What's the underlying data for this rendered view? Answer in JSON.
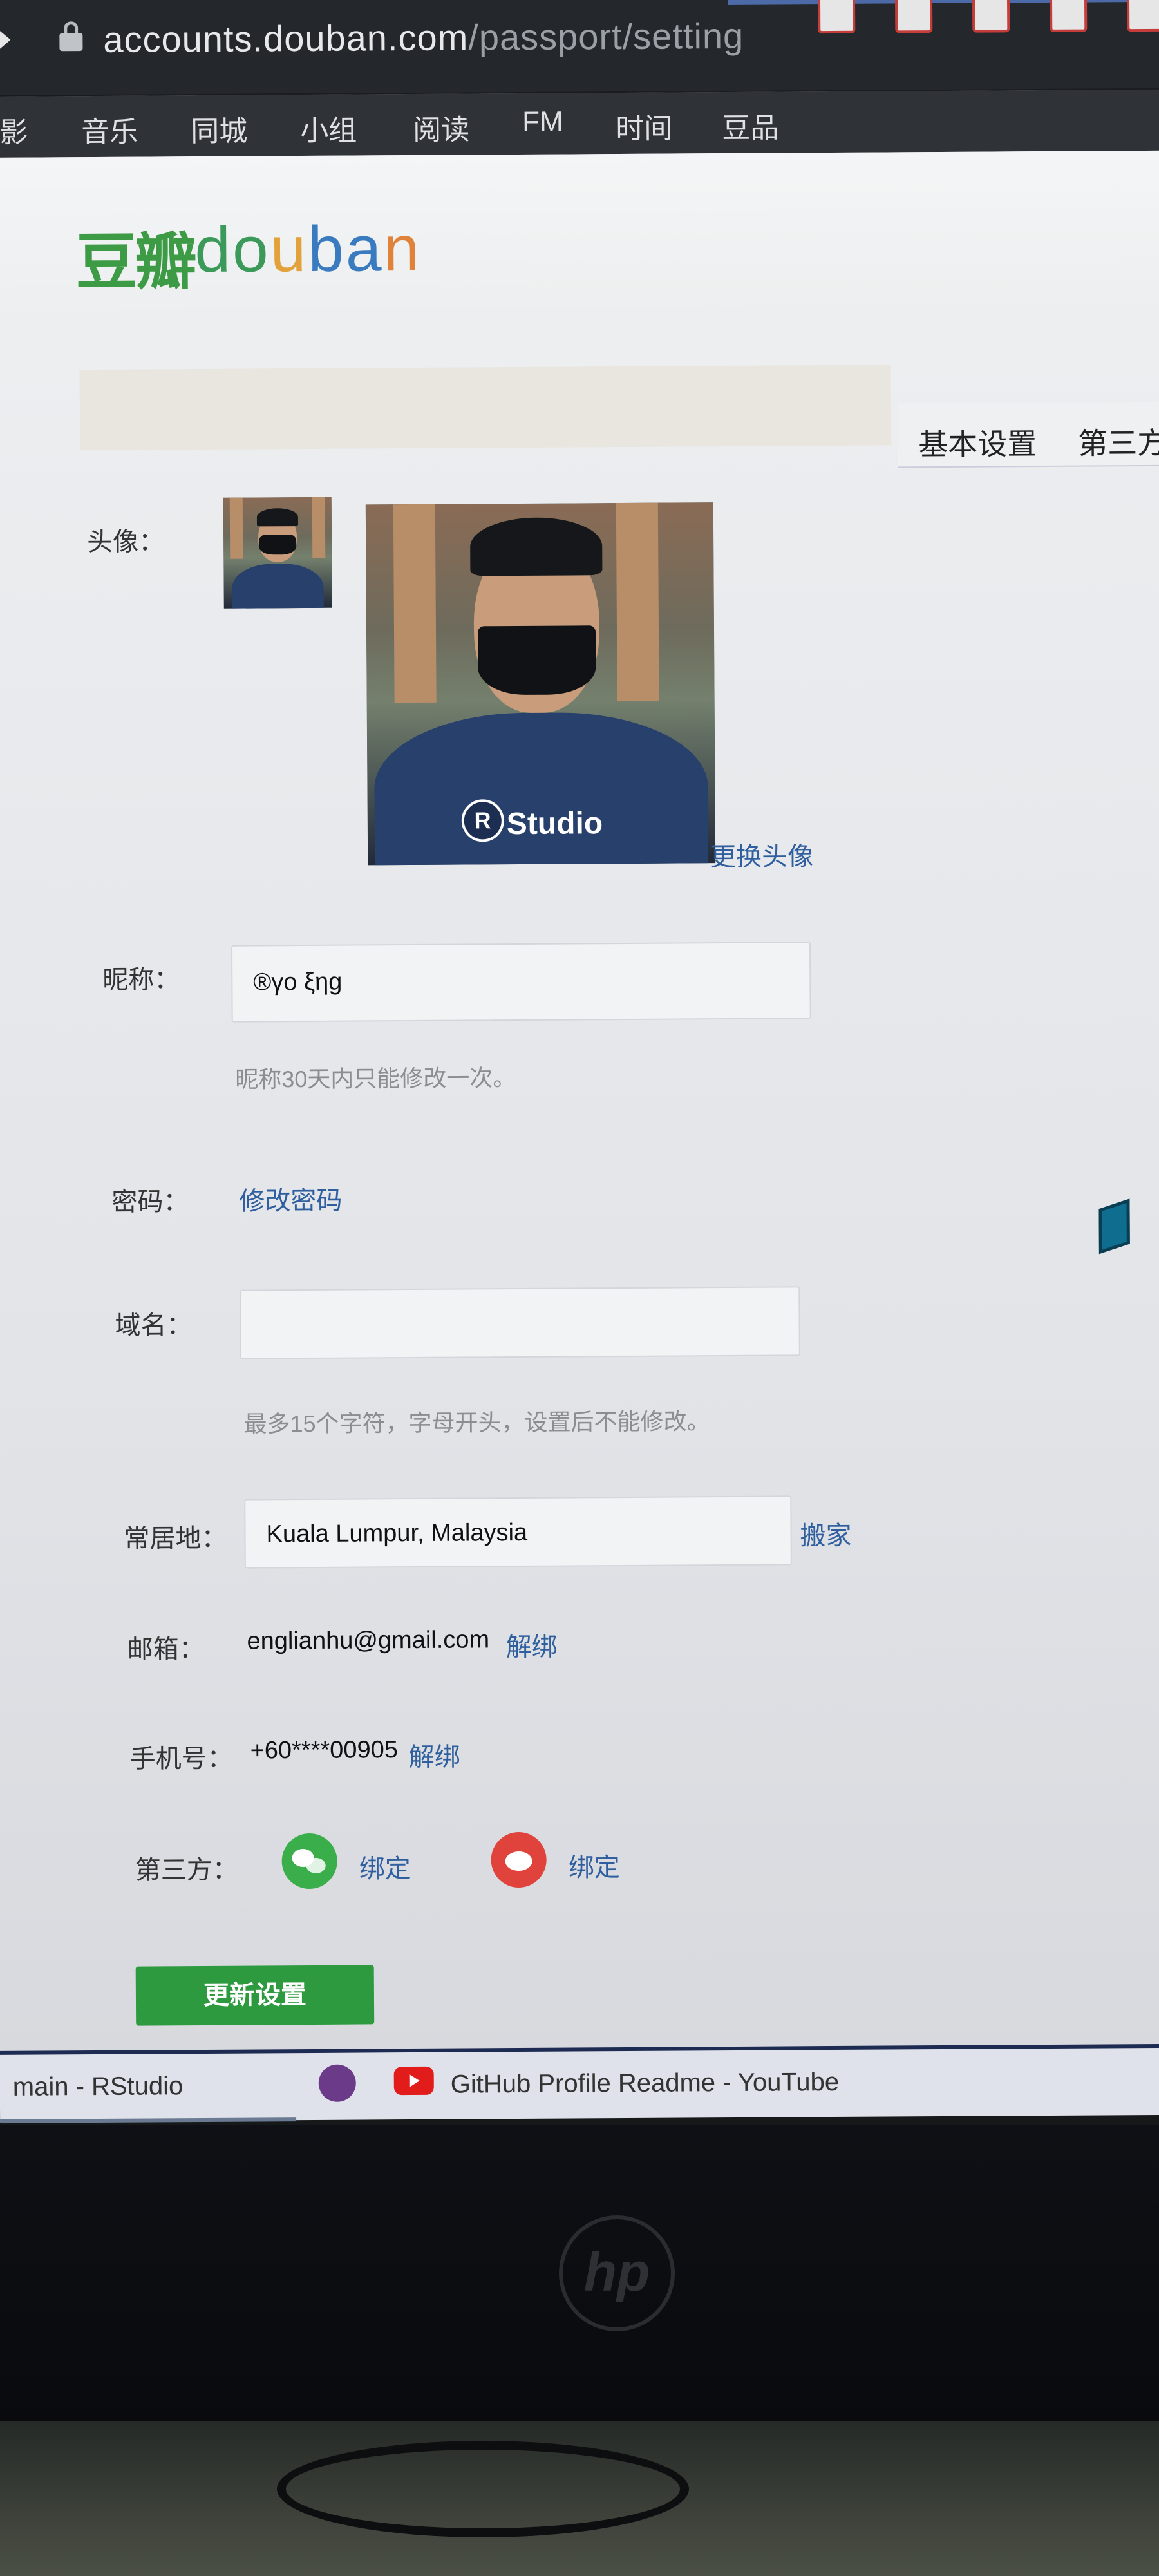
{
  "browser": {
    "url_host": "accounts.douban.com",
    "url_path": "/passport/setting"
  },
  "nav": {
    "items": [
      "影",
      "音乐",
      "同城",
      "小组",
      "阅读",
      "FM",
      "时间",
      "豆品"
    ]
  },
  "logo": {
    "cn": "豆瓣",
    "en_parts": [
      "do",
      "u",
      "ba",
      "n"
    ]
  },
  "tabs": [
    "基本设置",
    "第三方"
  ],
  "form": {
    "avatar_label": "头像：",
    "change_avatar": "更换头像",
    "nickname_label": "昵称：",
    "nickname_value": "®γο ξηg",
    "nickname_hint": "昵称30天内只能修改一次。",
    "password_label": "密码：",
    "password_link": "修改密码",
    "domain_label": "域名：",
    "domain_value": "",
    "domain_hint": "最多15个字符，字母开头，设置后不能修改。",
    "location_label": "常居地：",
    "location_value": "Kuala Lumpur, Malaysia",
    "location_link": "搬家",
    "email_label": "邮箱：",
    "email_value": "englianhu@gmail.com",
    "email_link": "解绑",
    "phone_label": "手机号：",
    "phone_value": "+60****00905",
    "phone_link": "解绑",
    "thirdparty_label": "第三方：",
    "wechat_bind": "绑定",
    "weibo_bind": "绑定",
    "submit": "更新设置"
  },
  "avatar_shirt_text": "Studio",
  "taskbar": {
    "item1": "main - RStudio",
    "item3": "GitHub Profile Readme - YouTube"
  },
  "monitor_brand": "hp",
  "colors": {
    "douban_green": "#3d9a45",
    "link_blue": "#2f5f9e",
    "button_green": "#2e9a40",
    "wechat": "#3aae4a",
    "weibo": "#e0433c"
  }
}
